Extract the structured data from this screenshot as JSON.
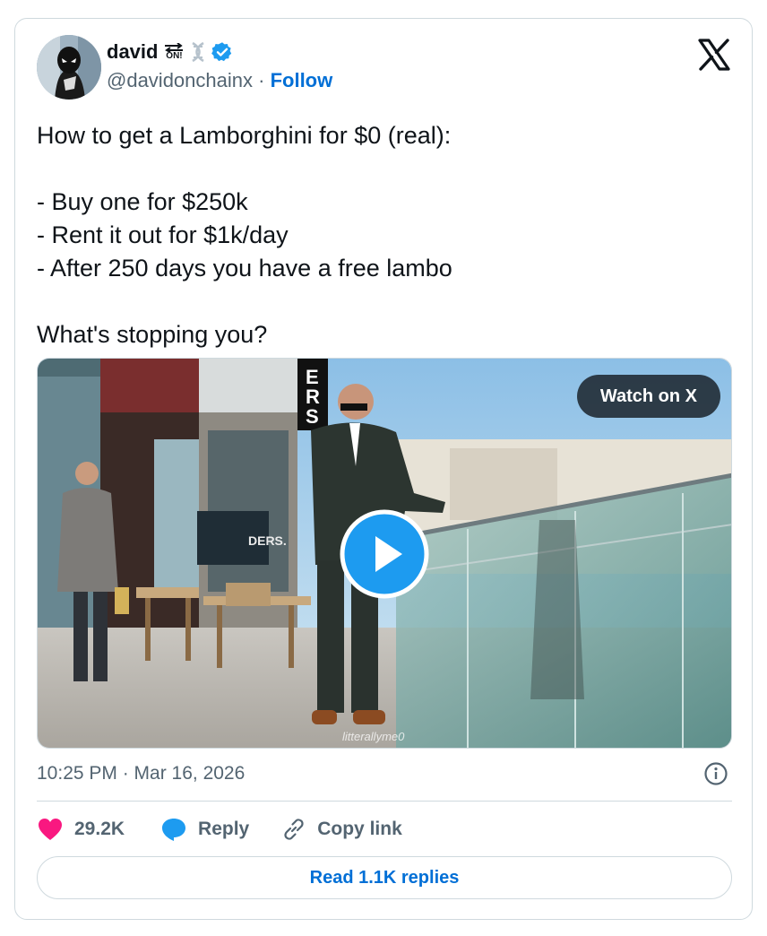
{
  "author": {
    "name": "david",
    "badge_text": "ON!",
    "handle": "@davidonchainx",
    "separator": "·",
    "follow_label": "Follow"
  },
  "tweet": {
    "text": "How to get a Lamborghini for $0 (real):\n\n- Buy one for $250k\n- Rent it out for $1k/day\n- After 250 days you have a free lambo\n\nWhat's stopping you?"
  },
  "media": {
    "watch_label": "Watch on X",
    "sign_letters": "ERS",
    "store_sign": "DERS.",
    "watermark": "litterallyme0"
  },
  "meta": {
    "timestamp": "10:25 PM · Mar 16, 2026"
  },
  "actions": {
    "likes": "29.2K",
    "reply_label": "Reply",
    "copy_label": "Copy link"
  },
  "read_replies_label": "Read 1.1K replies",
  "colors": {
    "accent": "#006fd6",
    "verified": "#1d9bf0",
    "like": "#f91880",
    "muted": "#536471",
    "border": "#cfd9de"
  }
}
